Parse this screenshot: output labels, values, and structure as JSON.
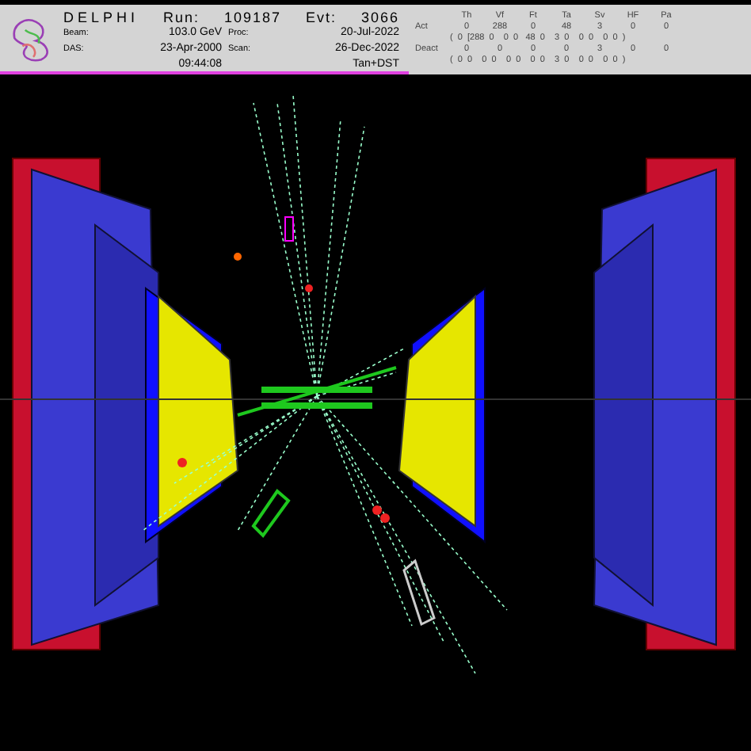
{
  "header": {
    "title": "DELPHI",
    "run": {
      "label": "Run:",
      "value": "109187"
    },
    "event": {
      "label": "Evt:",
      "value": "3066"
    },
    "beam": {
      "label": "Beam:",
      "value": "103.0 GeV"
    },
    "proc": {
      "label": "Proc:",
      "value": "20-Jul-2022"
    },
    "das": {
      "label": "DAS:",
      "value": "23-Apr-2000"
    },
    "scan": {
      "label": "Scan:",
      "value": "26-Dec-2022"
    },
    "time": "09:44:08",
    "data_type": "Tan+DST"
  },
  "trigger_table": {
    "columns": [
      "Th",
      "Vf",
      "Ft",
      "Ta",
      "Sv",
      "HF",
      "Pa"
    ],
    "rows": [
      {
        "label": "Act",
        "values": [
          "0",
          "288",
          "0",
          "48",
          "3",
          "0",
          "0"
        ],
        "detail": "(  0  [288  0    0  0   48  0    3  0    0  0    0  0  )"
      },
      {
        "label": "Deact",
        "values": [
          "0",
          "0",
          "0",
          "0",
          "3",
          "0",
          "0"
        ],
        "detail": "(  0  0    0  0    0  0    0  0    3  0    0  0    0  0  )"
      }
    ]
  }
}
